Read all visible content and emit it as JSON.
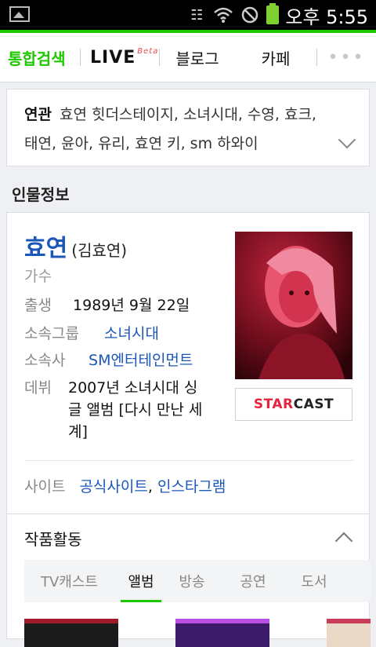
{
  "status_bar": {
    "time": "오후 5:55"
  },
  "tabs": {
    "integrated": "통합검색",
    "live": "LIVE",
    "live_beta": "Beta",
    "blog": "블로그",
    "cafe": "카페",
    "more": "•••"
  },
  "related": {
    "label": "연관",
    "keywords": "효연 힛더스테이지, 소녀시대, 수영, 효크, 태연, 윤아, 유리, 효연 키, sm 하와이"
  },
  "person_section_title": "인물정보",
  "person": {
    "name": "효연",
    "real_name": "(김효연)",
    "job": "가수",
    "birth_label": "출생",
    "birth_value": "1989년 9월 22일",
    "group_label": "소속그룹",
    "group_value": "소녀시대",
    "agency_label": "소속사",
    "agency_value": "SM엔터테인먼트",
    "debut_label": "데뷔",
    "debut_line1": "2007년 소녀시대 싱",
    "debut_line2": "글 앨범 [다시 만난 세",
    "debut_line3": "계]",
    "site_label": "사이트",
    "site_official": "공식사이트",
    "site_sep": ",",
    "site_instagram": "인스타그램"
  },
  "starcast": {
    "part1": "STAR",
    "part2": "CAST"
  },
  "works": {
    "title": "작품활동",
    "tabs": [
      "TV캐스트",
      "앨범",
      "방송",
      "공연",
      "도서"
    ],
    "active_tab": "앨범"
  },
  "colors": {
    "accent": "#1ec800",
    "link": "#1a57b9",
    "starcast_red": "#e5253f"
  }
}
